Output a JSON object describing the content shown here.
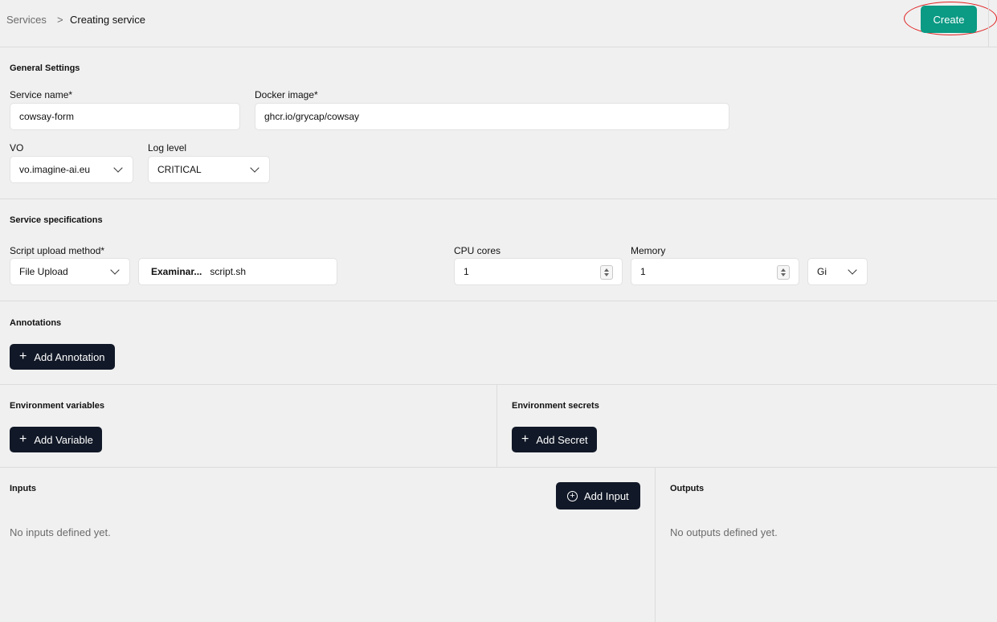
{
  "breadcrumb": {
    "parent": "Services",
    "separator": ">",
    "current": "Creating service"
  },
  "header": {
    "create_label": "Create",
    "create_color": "#0b9a84"
  },
  "general": {
    "title": "General Settings",
    "service_name_label": "Service name*",
    "service_name_value": "cowsay-form",
    "docker_image_label": "Docker image*",
    "docker_image_value": "ghcr.io/grycap/cowsay",
    "vo_label": "VO",
    "vo_value": "vo.imagine-ai.eu",
    "log_level_label": "Log level",
    "log_level_value": "CRITICAL"
  },
  "specs": {
    "title": "Service specifications",
    "script_method_label": "Script upload method*",
    "script_method_value": "File Upload",
    "browse_label": "Examinar...",
    "file_name": "script.sh",
    "cpu_label": "CPU cores",
    "cpu_value": "1",
    "memory_label": "Memory",
    "memory_value": "1",
    "memory_unit": "Gi"
  },
  "annotations": {
    "title": "Annotations",
    "add_label": "Add Annotation"
  },
  "env_vars": {
    "title": "Environment variables",
    "add_label": "Add Variable"
  },
  "env_secrets": {
    "title": "Environment secrets",
    "add_label": "Add Secret"
  },
  "inputs": {
    "title": "Inputs",
    "add_label": "Add Input",
    "empty_text": "No inputs defined yet."
  },
  "outputs": {
    "title": "Outputs",
    "empty_text": "No outputs defined yet."
  },
  "icons": {
    "plus": "plus-icon",
    "plus_circle": "plus-circle-icon",
    "chevron": "chevron-down-icon"
  }
}
